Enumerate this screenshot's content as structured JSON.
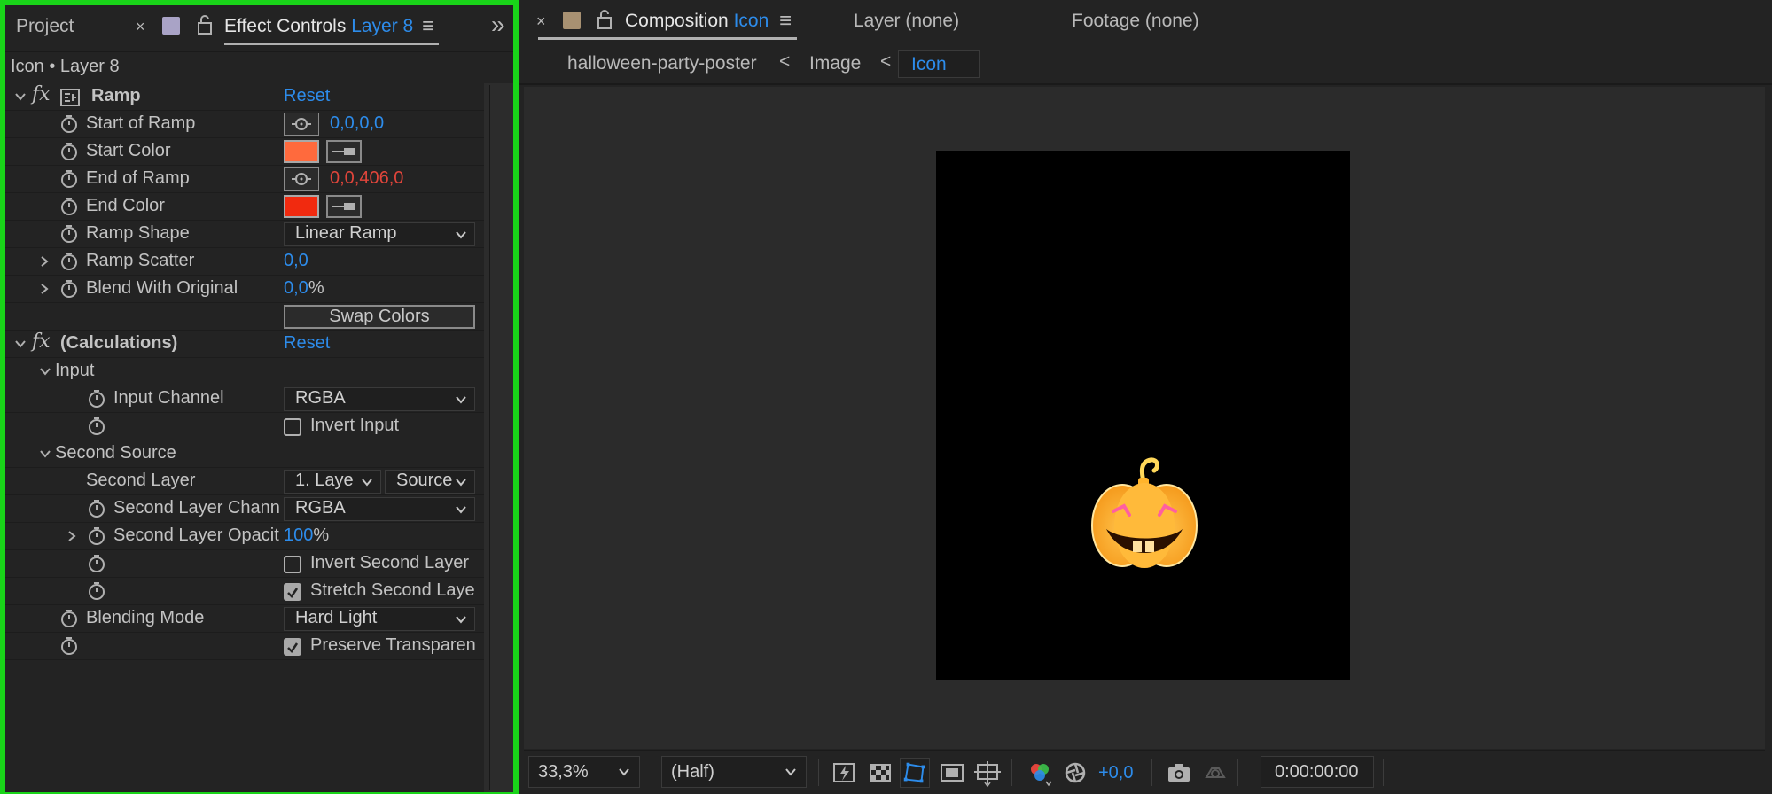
{
  "left_panel": {
    "tabs": {
      "project": "Project",
      "close": "×",
      "effect_controls_prefix": "Effect Controls",
      "effect_controls_layer": "Layer 8",
      "menu": "≡",
      "overflow": "»"
    },
    "subheader": "Icon • Layer 8",
    "ramp": {
      "fx": "fx",
      "name": "Ramp",
      "reset": "Reset",
      "start_of_ramp_label": "Start of Ramp",
      "start_of_ramp_value": "0,0,0,0",
      "start_color_label": "Start Color",
      "start_color": "#ff6a3d",
      "end_of_ramp_label": "End of Ramp",
      "end_of_ramp_a": "0,0,",
      "end_of_ramp_b": "406,0",
      "end_color_label": "End Color",
      "end_color": "#f12a0f",
      "ramp_shape_label": "Ramp Shape",
      "ramp_shape_value": "Linear Ramp",
      "ramp_scatter_label": "Ramp Scatter",
      "ramp_scatter_value": "0,0",
      "blend_label": "Blend With Original",
      "blend_value": "0,0",
      "blend_unit": "%",
      "swap_colors": "Swap Colors"
    },
    "calculations": {
      "fx": "fx",
      "name": "(Calculations)",
      "reset": "Reset",
      "input_group": "Input",
      "input_channel_label": "Input Channel",
      "input_channel_value": "RGBA",
      "invert_input": "Invert Input",
      "second_source_group": "Second Source",
      "second_layer_label": "Second Layer",
      "second_layer_value": "1. Laye",
      "second_layer_source": "Source",
      "second_layer_channel_label": "Second Layer Chann",
      "second_layer_channel_value": "RGBA",
      "second_layer_opacity_label": "Second Layer Opacit",
      "second_layer_opacity_value": "100",
      "second_layer_opacity_unit": "%",
      "invert_second_layer": "Invert Second Layer",
      "stretch_second_layer": "Stretch Second Laye",
      "blending_mode_label": "Blending Mode",
      "blending_mode_value": "Hard Light",
      "preserve_transparency": "Preserve Transparen"
    }
  },
  "composition_panel": {
    "close": "×",
    "tab_prefix": "Composition",
    "tab_name": "Icon",
    "menu": "≡",
    "layer_tab": "Layer (none)",
    "footage_tab": "Footage (none)",
    "breadcrumbs": [
      "halloween-party-poster",
      "Image",
      "Icon"
    ],
    "breadcrumb_sep": "<"
  },
  "viewer_toolbar": {
    "zoom": "33,3%",
    "resolution": "(Half)",
    "exposure": "+0,0",
    "timecode": "0:00:00:00"
  },
  "colors": {
    "accent": "#2d8ceb",
    "highlight_border": "#19d419",
    "keyframed_value": "#e0453b"
  }
}
